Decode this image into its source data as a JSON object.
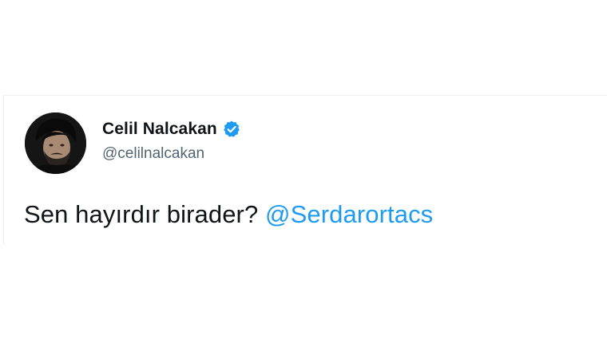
{
  "tweet": {
    "author": {
      "display_name": "Celil Nalcakan",
      "handle": "@celilnalcakan",
      "verified": true
    },
    "text": "Sen hayırdır birader?",
    "mention": "@Serdarortacs"
  },
  "colors": {
    "text": "#0f1419",
    "handle": "#536471",
    "accent": "#1d9bf0",
    "verified_badge": "#1d9bf0"
  },
  "icons": {
    "verified": "verified-badge-icon"
  }
}
